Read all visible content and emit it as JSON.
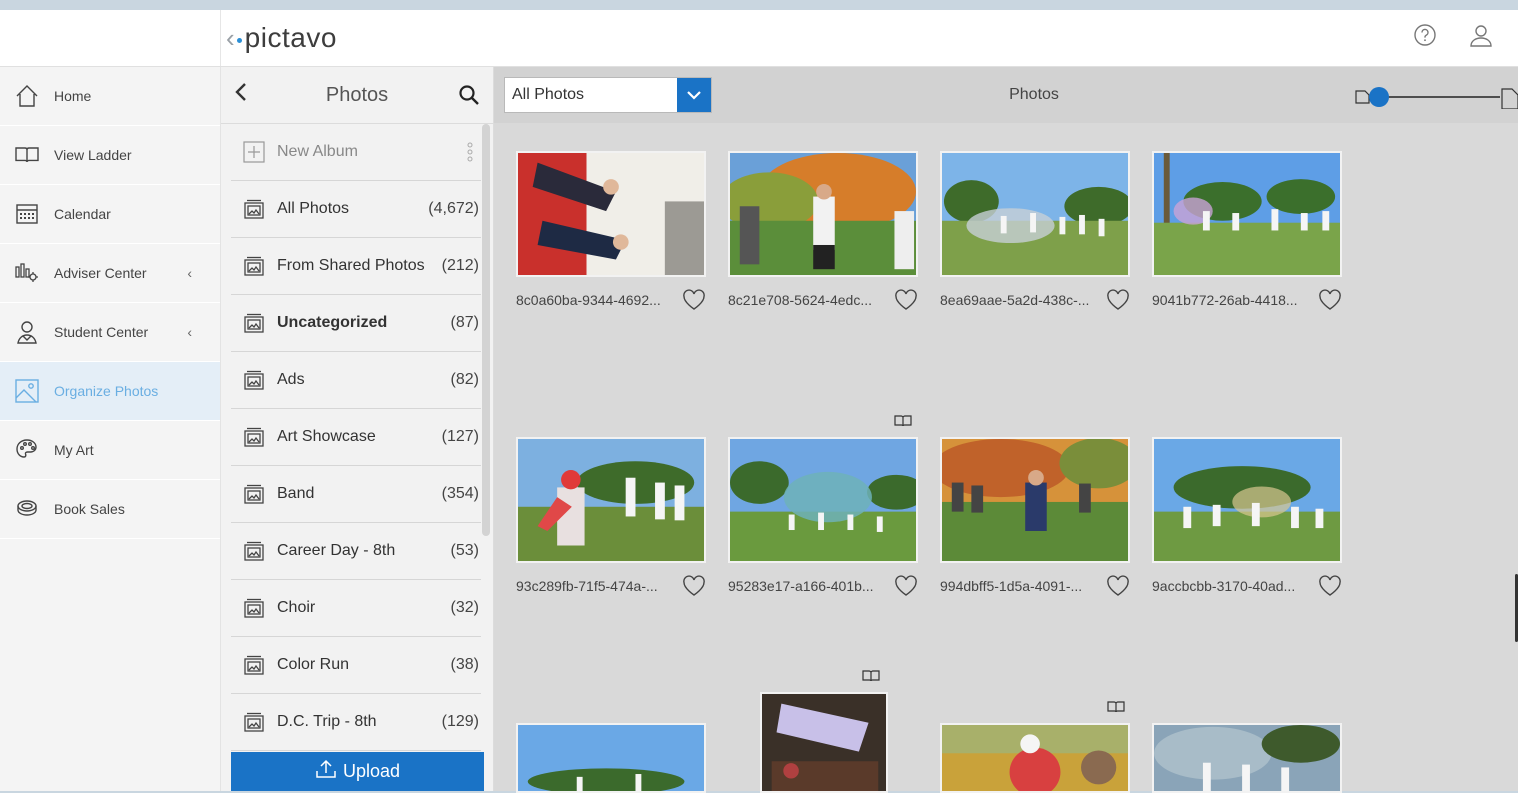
{
  "app": {
    "logo": "pictavo"
  },
  "sidebar": {
    "items": [
      {
        "label": "Home",
        "icon": "home-icon"
      },
      {
        "label": "View Ladder",
        "icon": "book-icon"
      },
      {
        "label": "Calendar",
        "icon": "calendar-icon"
      },
      {
        "label": "Adviser Center",
        "icon": "adviser-icon"
      },
      {
        "label": "Student Center",
        "icon": "student-icon"
      },
      {
        "label": "Organize Photos",
        "icon": "photo-icon"
      },
      {
        "label": "My Art",
        "icon": "palette-icon"
      },
      {
        "label": "Book Sales",
        "icon": "coins-icon"
      }
    ]
  },
  "albums": {
    "title": "Photos",
    "new_album": "New Album",
    "items": [
      {
        "name": "All Photos",
        "count": "(4,672)"
      },
      {
        "name": "From Shared Photos",
        "count": "(212)"
      },
      {
        "name": "Uncategorized",
        "count": "(87)"
      },
      {
        "name": "Ads",
        "count": "(82)"
      },
      {
        "name": "Art Showcase",
        "count": "(127)"
      },
      {
        "name": "Band",
        "count": "(354)"
      },
      {
        "name": "Career Day - 8th",
        "count": "(53)"
      },
      {
        "name": "Choir",
        "count": "(32)"
      },
      {
        "name": "Color Run",
        "count": "(38)"
      },
      {
        "name": "D.C. Trip - 8th",
        "count": "(129)"
      }
    ],
    "upload_label": "Upload"
  },
  "main": {
    "filter_value": "All Photos",
    "title": "Photos",
    "photos": [
      {
        "name": "8c0a60ba-9344-4692..."
      },
      {
        "name": "8c21e708-5624-4edc..."
      },
      {
        "name": "8ea69aae-5a2d-438c-..."
      },
      {
        "name": "9041b772-26ab-4418..."
      },
      {
        "name": "93c289fb-71f5-474a-..."
      },
      {
        "name": "95283e17-a166-401b..."
      },
      {
        "name": "994dbff5-1d5a-4091-..."
      },
      {
        "name": "9accbcbb-3170-40ad..."
      }
    ]
  },
  "colors": {
    "accent": "#1a73c6",
    "active_nav": "#6aaee2"
  }
}
